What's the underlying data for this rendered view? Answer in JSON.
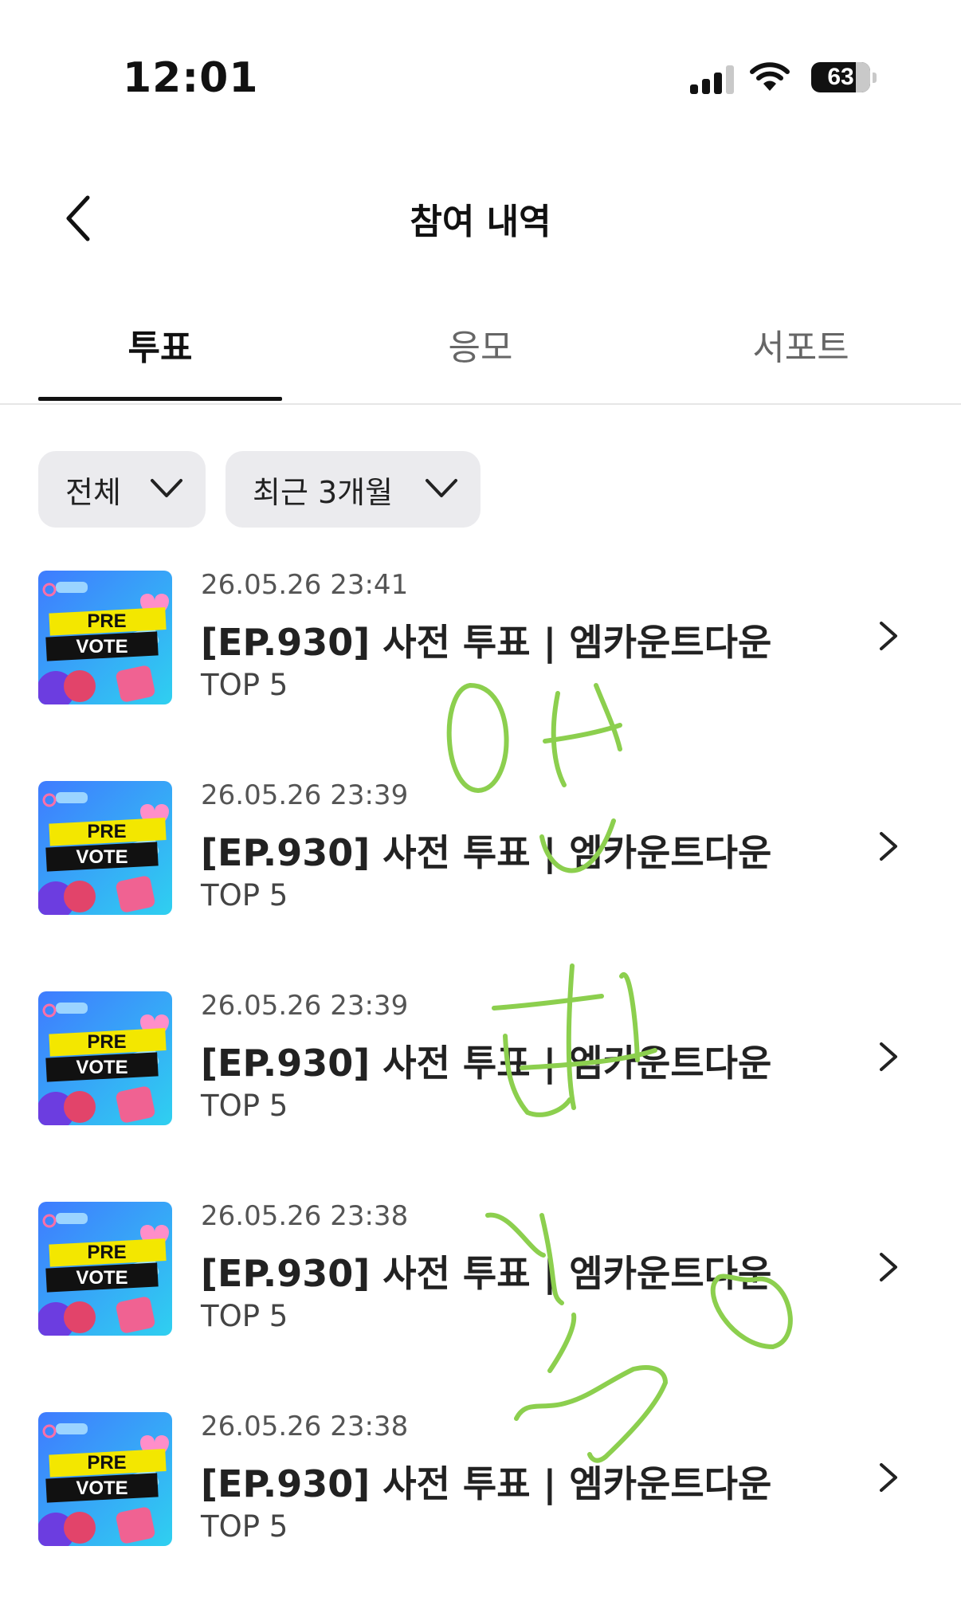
{
  "status_bar": {
    "time": "12:01",
    "battery": "63"
  },
  "header": {
    "title": "참여 내역",
    "back_icon": "chevron-left-icon"
  },
  "tabs": [
    {
      "label": "투표",
      "active": true
    },
    {
      "label": "응모",
      "active": false
    },
    {
      "label": "서포트",
      "active": false
    }
  ],
  "filters": [
    {
      "label": "전체"
    },
    {
      "label": "최근 3개월"
    }
  ],
  "list": [
    {
      "date": "26.05.26 23:41",
      "title": "[EP.930] 사전 투표 | 엠카운트다운",
      "sub": "TOP 5",
      "thumb_top": "PRE",
      "thumb_bottom": "VOTE"
    },
    {
      "date": "26.05.26 23:39",
      "title": "[EP.930] 사전 투표 | 엠카운트다운",
      "sub": "TOP 5",
      "thumb_top": "PRE",
      "thumb_bottom": "VOTE"
    },
    {
      "date": "26.05.26 23:39",
      "title": "[EP.930] 사전 투표 | 엠카운트다운",
      "sub": "TOP 5",
      "thumb_top": "PRE",
      "thumb_bottom": "VOTE"
    },
    {
      "date": "26.05.26 23:38",
      "title": "[EP.930] 사전 투표 | 엠카운트다운",
      "sub": "TOP 5",
      "thumb_top": "PRE",
      "thumb_bottom": "VOTE"
    },
    {
      "date": "26.05.26 23:38",
      "title": "[EP.930] 사전 투표 | 엠카운트다운",
      "sub": "TOP 5",
      "thumb_top": "PRE",
      "thumb_bottom": "VOTE"
    }
  ],
  "colors": {
    "accent": "#111111",
    "chip_bg": "#ebebee",
    "scribble": "#8ccf4e"
  }
}
